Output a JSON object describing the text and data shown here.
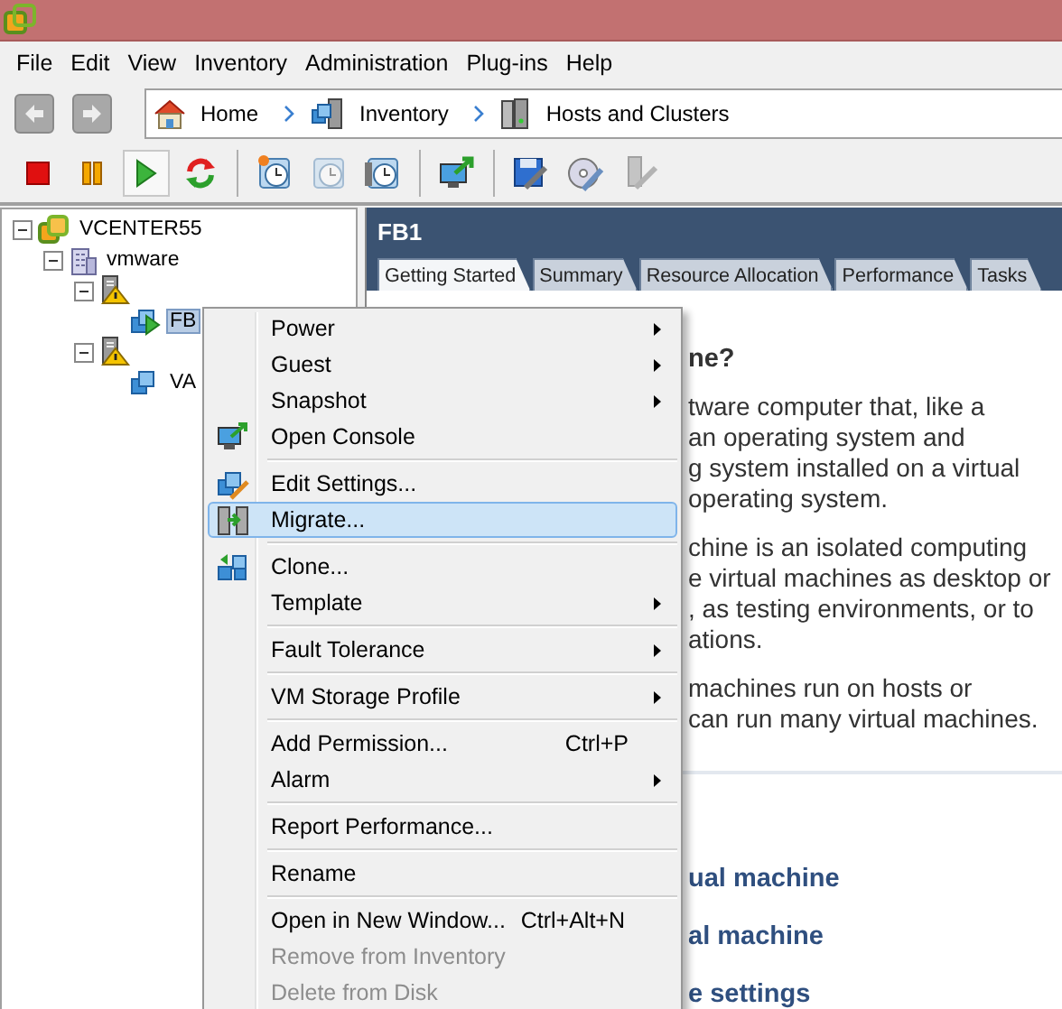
{
  "menu_bar": [
    "File",
    "Edit",
    "View",
    "Inventory",
    "Administration",
    "Plug-ins",
    "Help"
  ],
  "breadcrumb": [
    {
      "label": "Home",
      "kind": "home"
    },
    {
      "label": "Inventory",
      "kind": "inventory"
    },
    {
      "label": "Hosts and Clusters",
      "kind": "hosts"
    }
  ],
  "toolbar": [
    {
      "kind": "stop",
      "pressed": false
    },
    {
      "kind": "pause",
      "pressed": false
    },
    {
      "kind": "play",
      "pressed": true
    },
    {
      "kind": "reset",
      "pressed": false
    },
    {
      "kind": "sep"
    },
    {
      "kind": "snapshot",
      "pressed": false
    },
    {
      "kind": "revert",
      "pressed": false
    },
    {
      "kind": "manager",
      "pressed": false
    },
    {
      "kind": "sep"
    },
    {
      "kind": "console",
      "pressed": false
    },
    {
      "kind": "sep"
    },
    {
      "kind": "settings",
      "pressed": false
    },
    {
      "kind": "cd",
      "pressed": false
    },
    {
      "kind": "usb",
      "pressed": false
    }
  ],
  "tree": [
    {
      "label": "VCENTER55",
      "kind": "vcenter",
      "expanded": true,
      "selected": false,
      "children": [
        {
          "label": "vmware",
          "kind": "datacenter",
          "expanded": true,
          "selected": false,
          "children": [
            {
              "kind": "host",
              "expanded": true,
              "children": [
                {
                  "label": "FB",
                  "kind": "vm-running",
                  "selected": true
                }
              ]
            },
            {
              "kind": "host",
              "expanded": true,
              "children": [
                {
                  "label": "VA",
                  "kind": "vm",
                  "selected": false
                }
              ]
            }
          ]
        }
      ]
    }
  ],
  "panel": {
    "title": "FB1",
    "tabs": [
      {
        "label": "Getting Started",
        "selected": true
      },
      {
        "label": "Summary",
        "selected": false
      },
      {
        "label": "Resource Allocation",
        "selected": false
      },
      {
        "label": "Performance",
        "selected": false
      },
      {
        "label": "Tasks",
        "selected": false
      }
    ],
    "heading": "ne?",
    "paragraphs": [
      [
        "tware computer that, like a",
        "an operating system and",
        "g system installed on a virtual",
        "operating system."
      ],
      [
        "chine is an isolated computing",
        "e virtual machines as desktop or",
        ", as testing environments, or to",
        "ations."
      ],
      [
        "machines run on hosts or",
        "can run many virtual machines."
      ]
    ],
    "links": [
      "ual machine",
      "al machine",
      "e settings"
    ]
  },
  "context_menu": {
    "sections": [
      [
        {
          "label": "Power",
          "kind": "plain",
          "submenu": true,
          "disabled": false,
          "selected": false
        },
        {
          "label": "Guest",
          "kind": "plain",
          "submenu": true,
          "disabled": false,
          "selected": false
        },
        {
          "label": "Snapshot",
          "kind": "plain",
          "submenu": true,
          "disabled": false,
          "selected": false
        },
        {
          "label": "Open Console",
          "kind": "console",
          "submenu": false,
          "disabled": false,
          "selected": false
        }
      ],
      [
        {
          "label": "Edit Settings...",
          "kind": "settings",
          "submenu": false,
          "disabled": false,
          "selected": false
        },
        {
          "label": "Migrate...",
          "kind": "migrate",
          "submenu": false,
          "disabled": false,
          "selected": true
        }
      ],
      [
        {
          "label": "Clone...",
          "kind": "clone",
          "submenu": false,
          "disabled": false,
          "selected": false
        },
        {
          "label": "Template",
          "kind": "plain",
          "submenu": true,
          "disabled": false,
          "selected": false
        }
      ],
      [
        {
          "label": "Fault Tolerance",
          "kind": "plain",
          "submenu": true,
          "disabled": false,
          "selected": false
        }
      ],
      [
        {
          "label": "VM Storage Profile",
          "kind": "plain",
          "submenu": true,
          "disabled": false,
          "selected": false
        }
      ],
      [
        {
          "label": "Add Permission...",
          "shortcut": "Ctrl+P",
          "kind": "plain",
          "submenu": false,
          "disabled": false,
          "selected": false
        },
        {
          "label": "Alarm",
          "kind": "plain",
          "submenu": true,
          "disabled": false,
          "selected": false
        }
      ],
      [
        {
          "label": "Report Performance...",
          "kind": "plain",
          "submenu": false,
          "disabled": false,
          "selected": false
        }
      ],
      [
        {
          "label": "Rename",
          "kind": "plain",
          "submenu": false,
          "disabled": false,
          "selected": false
        }
      ],
      [
        {
          "label": "Open in New Window...",
          "shortcut": "Ctrl+Alt+N",
          "kind": "plain",
          "submenu": false,
          "disabled": false,
          "selected": false
        },
        {
          "label": "Remove from Inventory",
          "kind": "plain",
          "submenu": false,
          "disabled": true,
          "selected": false
        },
        {
          "label": "Delete from Disk",
          "kind": "plain",
          "submenu": false,
          "disabled": true,
          "selected": false
        }
      ]
    ]
  }
}
